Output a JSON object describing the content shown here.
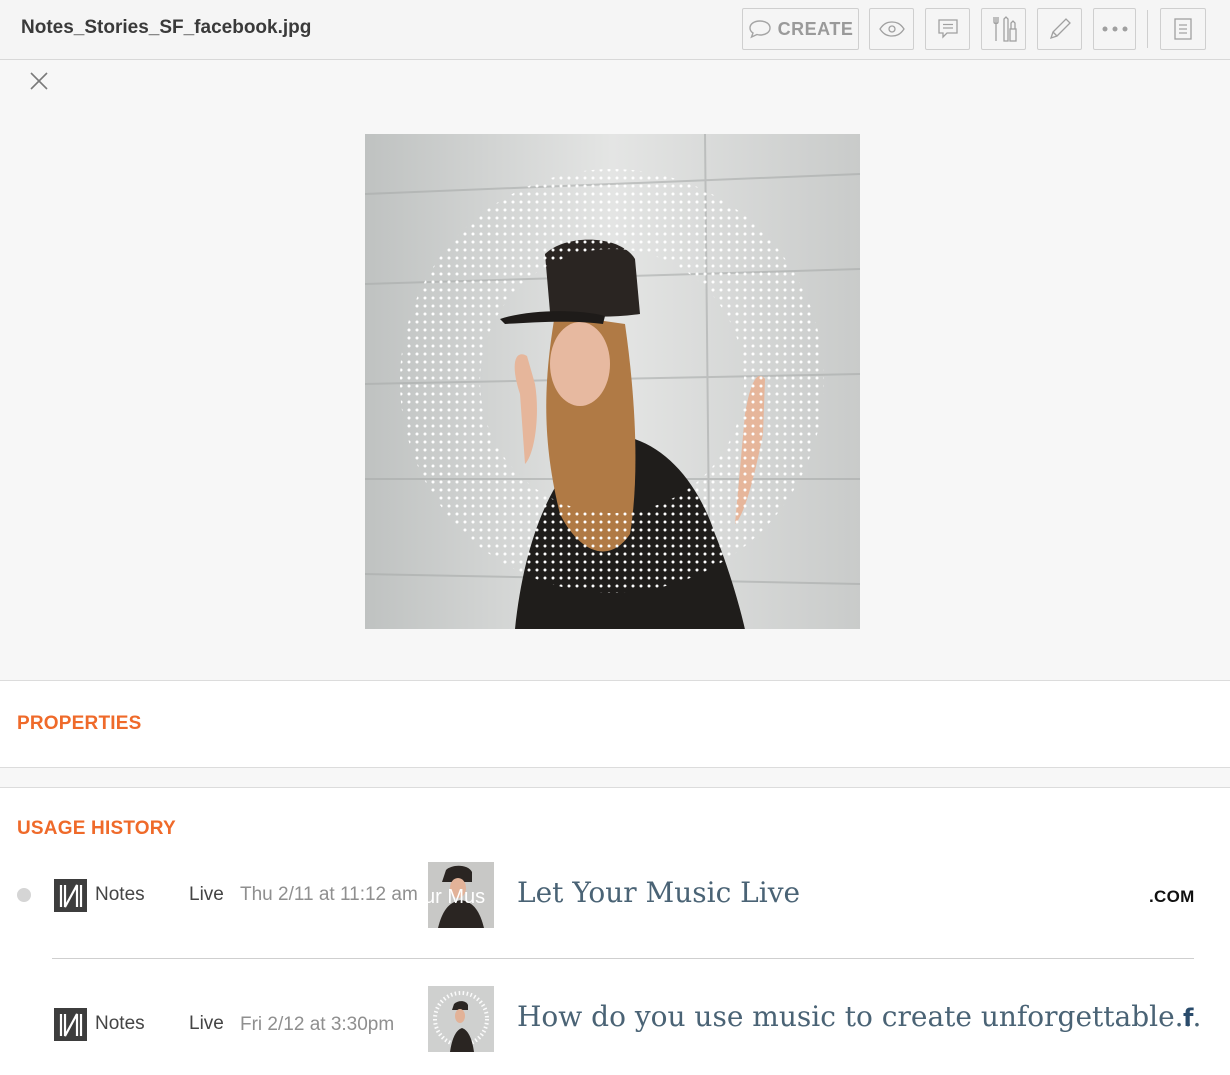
{
  "header": {
    "filename": "Notes_Stories_SF_facebook.jpg",
    "create_label": "CREATE",
    "icons": [
      "speech-bubble-icon",
      "eye-icon",
      "comment-icon",
      "tools-icon",
      "pencil-icon",
      "more-icon",
      "document-icon"
    ]
  },
  "close_icon": "close-icon",
  "properties": {
    "title": "PROPERTIES"
  },
  "usage_history": {
    "title": "USAGE HISTORY",
    "rows": [
      {
        "source": "Notes",
        "status": "Live",
        "date": "Thu 2/11 at 11:12 am",
        "thumb_text": "ur Mus",
        "headline": "Let Your Music Live",
        "channel": ".COM"
      },
      {
        "source": "Notes",
        "status": "Live",
        "date": "Fri 2/12 at 3:30pm",
        "headline": "How do you use music to create unforgettable...",
        "channel": "f"
      }
    ]
  },
  "colors": {
    "accent": "#ef6a2a",
    "headline": "#4a6375",
    "facebook": "#2a4b6b"
  }
}
